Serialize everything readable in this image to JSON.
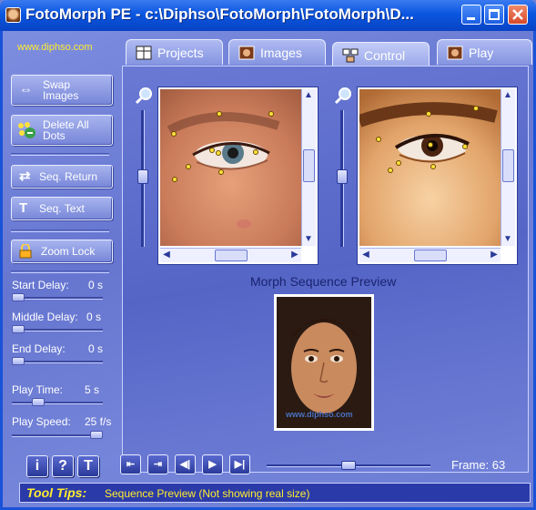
{
  "window": {
    "title": "FotoMorph PE - c:\\Diphso\\FotoMorph\\FotoMorph\\D..."
  },
  "website": "www.diphso.com",
  "tabs": [
    {
      "label": "Projects",
      "icon": "projects-icon"
    },
    {
      "label": "Images",
      "icon": "images-icon"
    },
    {
      "label": "Control",
      "icon": "control-icon",
      "active": true
    },
    {
      "label": "Play",
      "icon": "play-tab-icon"
    }
  ],
  "left_panel": {
    "swap_images": "Swap Images",
    "delete_all_dots": "Delete All Dots",
    "seq_return": "Seq. Return",
    "seq_text": "Seq. Text",
    "zoom_lock": "Zoom Lock",
    "start_delay": {
      "label": "Start Delay:",
      "value": "0 s",
      "level": 0
    },
    "middle_delay": {
      "label": "Middle Delay:",
      "value": "0 s",
      "level": 0
    },
    "end_delay": {
      "label": "End Delay:",
      "value": "0 s",
      "level": 0
    },
    "play_time": {
      "label": "Play Time:",
      "value": "5 s",
      "level": 0.25
    },
    "play_speed": {
      "label": "Play Speed:",
      "value": "25 f/s",
      "level": 1.0
    }
  },
  "preview": {
    "label": "Morph Sequence Preview",
    "watermark": "www.diphso.com"
  },
  "frame": {
    "label": "Frame: 63",
    "level": 0.5
  },
  "tooltips": {
    "title": "Tool Tips:",
    "text": "Sequence Preview (Not showing real size)"
  },
  "colors": {
    "titlebar": "#0a56e0",
    "client_bg": "#7080d8",
    "tooltip_text": "#ffec30",
    "dot": "#ffe13a"
  }
}
